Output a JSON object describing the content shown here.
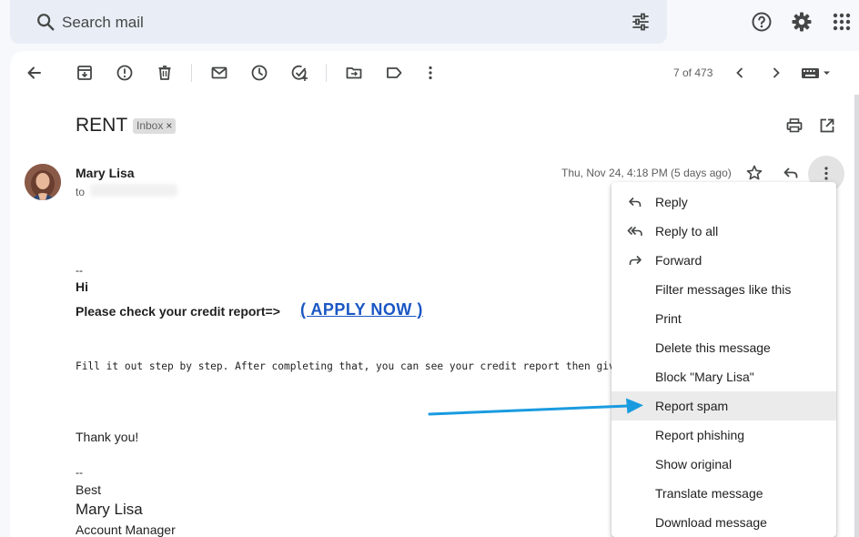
{
  "search": {
    "placeholder": "Search mail"
  },
  "toolbar": {
    "count": "7 of 473"
  },
  "email": {
    "subject": "RENT",
    "label_chip": "Inbox",
    "label_chip_close": "×",
    "sender": "Mary Lisa",
    "to_label": "to",
    "date": "Thu, Nov 24, 4:18 PM (5 days ago)",
    "body": {
      "dash1": "--",
      "greeting": "Hi",
      "cta_text": "Please check your credit report=>",
      "cta_link": "( APPLY NOW )",
      "instructions": "Fill it out step by step. After completing that, you can see your credit report then give",
      "thanks": "Thank you!",
      "dash2": "--",
      "closing": "Best",
      "signature_name": "Mary Lisa",
      "signature_title": "Account Manager"
    }
  },
  "menu": {
    "items": [
      {
        "label": "Reply",
        "icon": "reply-icon"
      },
      {
        "label": "Reply to all",
        "icon": "reply-all-icon"
      },
      {
        "label": "Forward",
        "icon": "forward-icon"
      },
      {
        "label": "Filter messages like this",
        "icon": ""
      },
      {
        "label": "Print",
        "icon": ""
      },
      {
        "label": "Delete this message",
        "icon": ""
      },
      {
        "label": "Block \"Mary Lisa\"",
        "icon": ""
      },
      {
        "label": "Report spam",
        "icon": "",
        "highlighted": true
      },
      {
        "label": "Report phishing",
        "icon": ""
      },
      {
        "label": "Show original",
        "icon": ""
      },
      {
        "label": "Translate message",
        "icon": ""
      },
      {
        "label": "Download message",
        "icon": ""
      }
    ]
  },
  "colors": {
    "link": "#1a57c4",
    "annotation_arrow": "#1a9be0",
    "menu_highlight": "#ebebeb",
    "search_bg": "#e9eef6"
  }
}
